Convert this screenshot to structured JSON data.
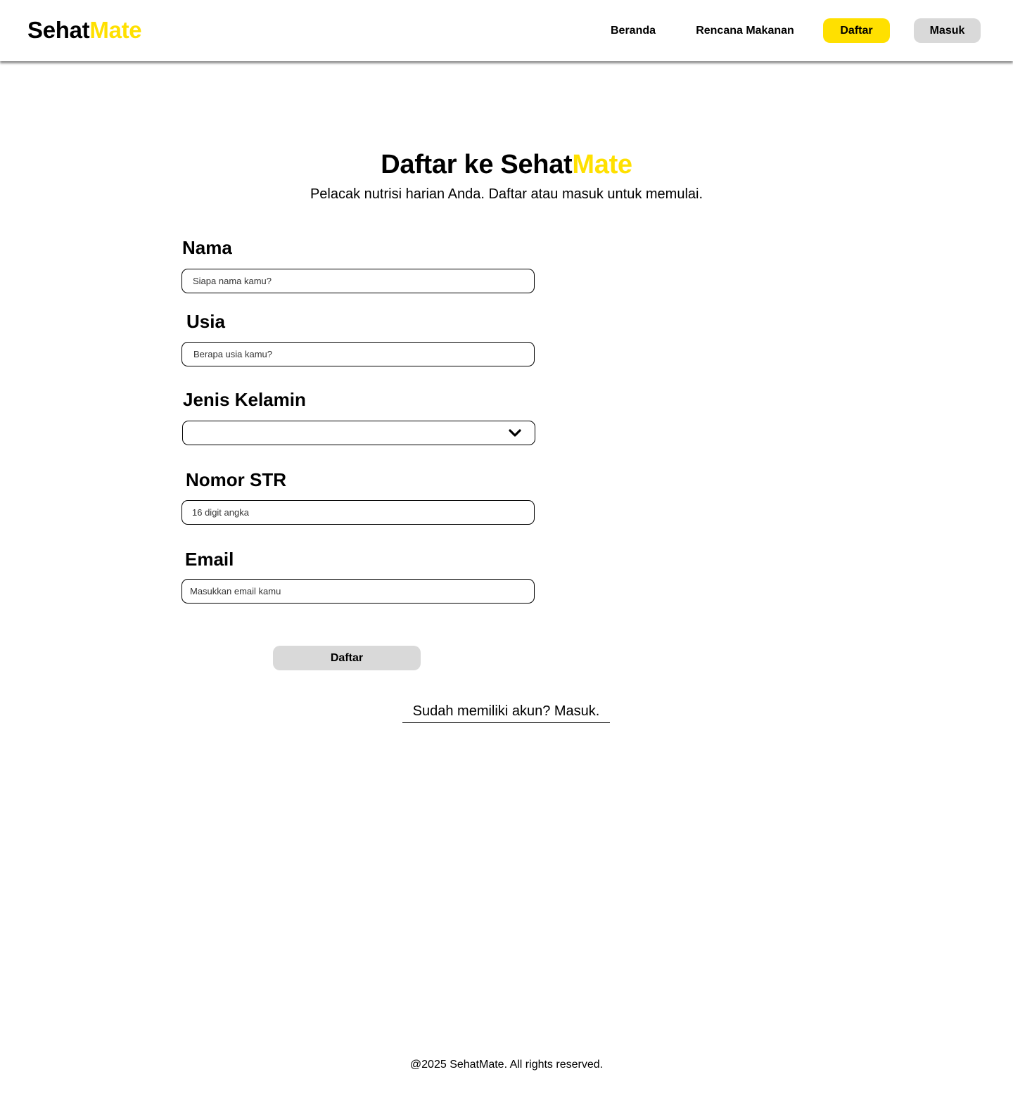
{
  "brand": {
    "logo_part1": "Sehat",
    "logo_part2": "Mate",
    "accent_color": "#FFE000"
  },
  "nav": {
    "beranda": "Beranda",
    "rencana": "Rencana Makanan",
    "daftar": "Daftar",
    "masuk": "Masuk"
  },
  "hero": {
    "title_prefix": "Daftar ke Sehat",
    "title_accent": "Mate",
    "subtitle": "Pelacak nutrisi harian Anda. Daftar atau masuk untuk memulai."
  },
  "form": {
    "nama_label": "Nama",
    "nama_placeholder": "Siapa nama kamu?",
    "usia_label": "Usia",
    "usia_placeholder": "Berapa usia kamu?",
    "jenis_kelamin_label": "Jenis Kelamin",
    "jenis_kelamin_value": "",
    "str_label": "Nomor STR",
    "str_placeholder": "16 digit angka",
    "email_label": "Email",
    "email_placeholder": "Masukkan email kamu",
    "submit_label": "Daftar",
    "login_link": "Sudah memiliki akun? Masuk."
  },
  "footer": {
    "copyright": "@2025 SehatMate. All rights reserved."
  },
  "icons": {
    "select_arrow": "chevron-down-icon"
  }
}
